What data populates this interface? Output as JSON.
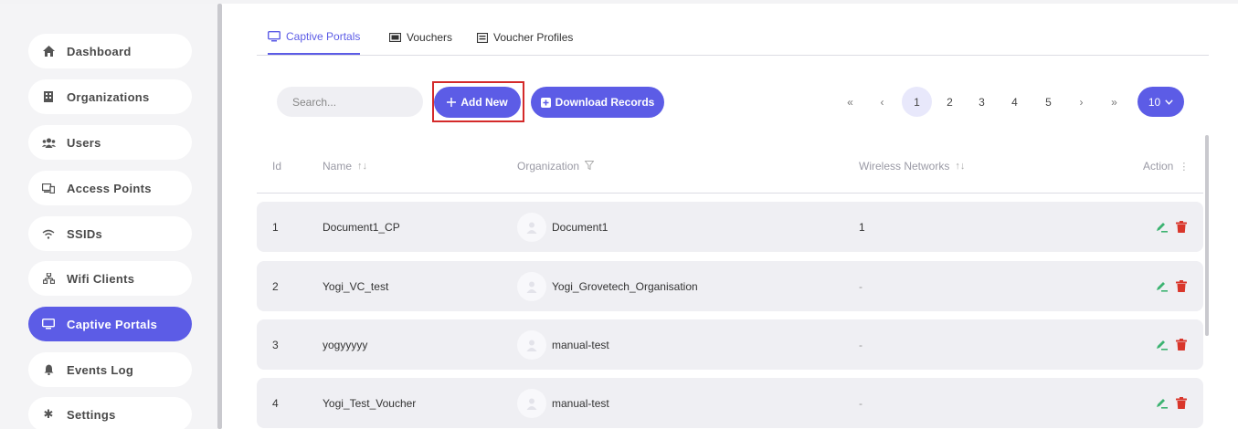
{
  "sidebar": {
    "items": [
      {
        "label": "Dashboard",
        "icon": "home-icon",
        "active": false
      },
      {
        "label": "Organizations",
        "icon": "building-icon",
        "active": false
      },
      {
        "label": "Users",
        "icon": "users-icon",
        "active": false
      },
      {
        "label": "Access Points",
        "icon": "devices-icon",
        "active": false
      },
      {
        "label": "SSIDs",
        "icon": "wifi-icon",
        "active": false
      },
      {
        "label": "Wifi Clients",
        "icon": "network-icon",
        "active": false
      },
      {
        "label": "Captive Portals",
        "icon": "monitor-icon",
        "active": true
      },
      {
        "label": "Events Log",
        "icon": "bell-icon",
        "active": false
      },
      {
        "label": "Settings",
        "icon": "gear-icon",
        "active": false
      }
    ]
  },
  "tabs": [
    {
      "label": "Captive Portals",
      "icon": "monitor-icon",
      "active": true
    },
    {
      "label": "Vouchers",
      "icon": "ticket-icon",
      "active": false
    },
    {
      "label": "Voucher Profiles",
      "icon": "list-icon",
      "active": false
    }
  ],
  "toolbar": {
    "search_placeholder": "Search...",
    "add_label": "Add New",
    "download_label": "Download Records"
  },
  "pagination": {
    "first": "«",
    "prev": "‹",
    "pages": [
      "1",
      "2",
      "3",
      "4",
      "5"
    ],
    "current": "1",
    "next": "›",
    "last": "»",
    "page_size": "10"
  },
  "table": {
    "headers": {
      "id": "Id",
      "name": "Name",
      "organization": "Organization",
      "wireless": "Wireless Networks",
      "action": "Action"
    },
    "rows": [
      {
        "id": "1",
        "name": "Document1_CP",
        "organization": "Document1",
        "wireless": "1"
      },
      {
        "id": "2",
        "name": "Yogi_VC_test",
        "organization": "Yogi_Grovetech_Organisation",
        "wireless": "-"
      },
      {
        "id": "3",
        "name": "yogyyyyy",
        "organization": "manual-test",
        "wireless": "-"
      },
      {
        "id": "4",
        "name": "Yogi_Test_Voucher",
        "organization": "manual-test",
        "wireless": "-"
      }
    ]
  },
  "colors": {
    "accent": "#5c5ce6",
    "edit": "#3cb371",
    "delete": "#d9362b",
    "highlight": "#d42a2a"
  }
}
